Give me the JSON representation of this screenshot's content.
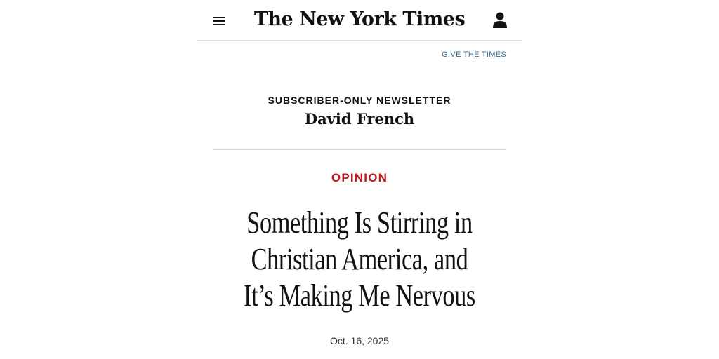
{
  "header": {
    "logo_text": "The New York Times",
    "menu_icon": "hamburger-menu-icon",
    "account_icon": "user-account-icon"
  },
  "give_link": "GIVE THE TIMES",
  "newsletter": {
    "kicker": "SUBSCRIBER-ONLY NEWSLETTER",
    "author": "David French"
  },
  "article": {
    "section": "OPINION",
    "headline_lines": [
      "Something Is Stirring in",
      "Christian America, and",
      "It’s Making Me Nervous"
    ],
    "date": "Oct. 16, 2025"
  },
  "colors": {
    "text": "#121212",
    "opinion_red": "#c2191f",
    "link_blue": "#326891"
  }
}
